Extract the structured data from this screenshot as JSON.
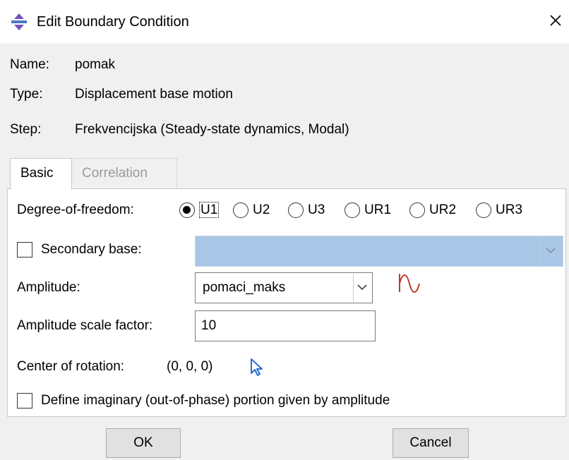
{
  "dialog": {
    "title": "Edit Boundary Condition",
    "close_icon": "close-icon",
    "title_icon": "boundary-condition-icon"
  },
  "info": {
    "name_label": "Name:",
    "name_value": "pomak",
    "type_label": "Type:",
    "type_value": "Displacement base motion",
    "step_label": "Step:",
    "step_value": "Frekvencijska (Steady-state dynamics, Modal)"
  },
  "tabs": [
    {
      "label": "Basic",
      "active": true
    },
    {
      "label": "Correlation",
      "active": false
    }
  ],
  "form": {
    "dof_label": "Degree-of-freedom:",
    "dof_options": [
      "U1",
      "U2",
      "U3",
      "UR1",
      "UR2",
      "UR3"
    ],
    "dof_selected": "U1",
    "secondary_base_label": "Secondary base:",
    "secondary_base_checked": false,
    "secondary_base_value": "",
    "amplitude_label": "Amplitude:",
    "amplitude_value": "pomaci_maks",
    "amplitude_icon": "amplitude-curve-icon",
    "scale_factor_label": "Amplitude scale factor:",
    "scale_factor_value": "10",
    "center_label": "Center of rotation:",
    "center_value": "(0, 0, 0)",
    "center_icon": "select-pointer-icon",
    "imaginary_label": "Define imaginary (out-of-phase) portion given by amplitude",
    "imaginary_checked": false
  },
  "buttons": {
    "ok": "OK",
    "cancel": "Cancel"
  },
  "colors": {
    "accent_blue": "#2a6fd6",
    "disabled_combo": "#a9c6e6",
    "amplitude_icon_red": "#c0392b"
  }
}
